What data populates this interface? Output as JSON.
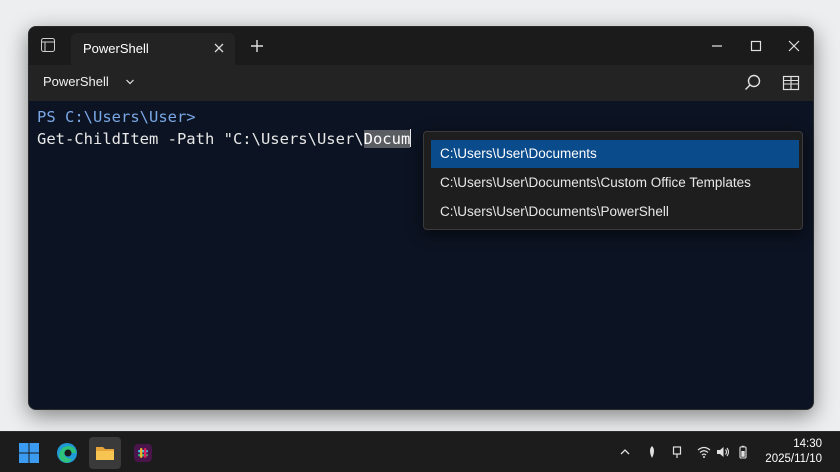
{
  "window": {
    "tab_title": "PowerShell",
    "profile_label": "PowerShell"
  },
  "terminal": {
    "prompt": "PS C:\\Users\\User>",
    "command_prefix": "Get-ChildItem -Path \"C:\\Users\\User\\",
    "command_selected": "Docum"
  },
  "suggestions": [
    "C:\\Users\\User\\Documents",
    "C:\\Users\\User\\Documents\\Custom Office Templates",
    "C:\\Users\\User\\Documents\\PowerShell"
  ],
  "suggestions_selected_index": 0,
  "taskbar": {
    "apps": [
      "start-icon",
      "edge-icon",
      "file-explorer-icon",
      "slack-icon"
    ],
    "time": "14:30",
    "date": "2025/11/10"
  },
  "colors": {
    "terminal_bg": "#0c1322",
    "prompt": "#7aa7e6",
    "selection_highlight": "#0a4b8c"
  }
}
